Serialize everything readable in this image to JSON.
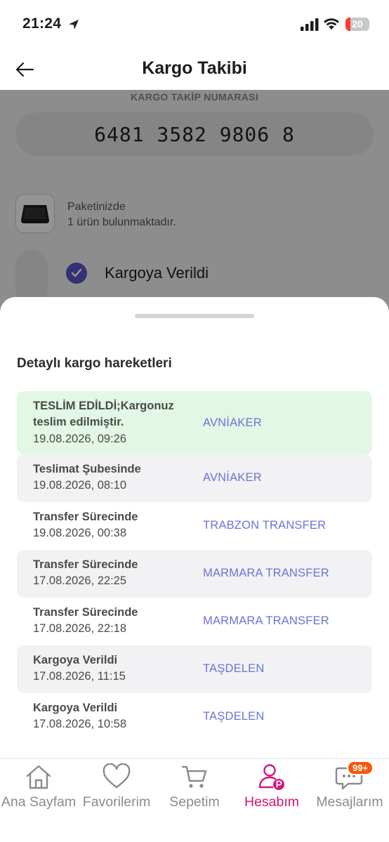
{
  "status_bar": {
    "time": "21:24",
    "battery": "20",
    "battery_level": 0.2
  },
  "nav": {
    "title": "Kargo Takibi"
  },
  "tracking": {
    "label": "KARGO TAKİP NUMARASI",
    "number": "6481 3582 9806 8"
  },
  "package": {
    "line1": "Paketinizde",
    "line2": "1 ürün bulunmaktadır."
  },
  "current_step": {
    "label": "Kargoya Verildi"
  },
  "sheet": {
    "title": "Detaylı kargo hareketleri",
    "movements": [
      {
        "status": "TESLİM EDİLDİ;Kargonuz teslim edilmiştir.",
        "date": "19.08.2026, 09:26",
        "location": "AVNİAKER"
      },
      {
        "status": "Teslimat Şubesinde",
        "date": "19.08.2026, 08:10",
        "location": "AVNİAKER"
      },
      {
        "status": "Transfer Sürecinde",
        "date": "19.08.2026, 00:38",
        "location": "TRABZON TRANSFER"
      },
      {
        "status": "Transfer Sürecinde",
        "date": "17.08.2026, 22:25",
        "location": "MARMARA TRANSFER"
      },
      {
        "status": "Transfer Sürecinde",
        "date": "17.08.2026, 22:18",
        "location": "MARMARA TRANSFER"
      },
      {
        "status": "Kargoya Verildi",
        "date": "17.08.2026, 11:15",
        "location": "TAŞDELEN"
      },
      {
        "status": "Kargoya Verildi",
        "date": "17.08.2026, 10:58",
        "location": "TAŞDELEN"
      }
    ]
  },
  "tabs": [
    {
      "label": "Ana Sayfam",
      "icon": "home-icon"
    },
    {
      "label": "Favorilerim",
      "icon": "heart-icon"
    },
    {
      "label": "Sepetim",
      "icon": "cart-icon"
    },
    {
      "label": "Hesabım",
      "icon": "account-icon",
      "active": true
    },
    {
      "label": "Mesajlarım",
      "icon": "message-icon",
      "badge": "99+"
    }
  ],
  "colors": {
    "accent": "#d6147a",
    "link": "#6a72dc",
    "delivered_bg": "#e2f8e5",
    "badge": "#f4590f",
    "check": "#5b55c9"
  }
}
